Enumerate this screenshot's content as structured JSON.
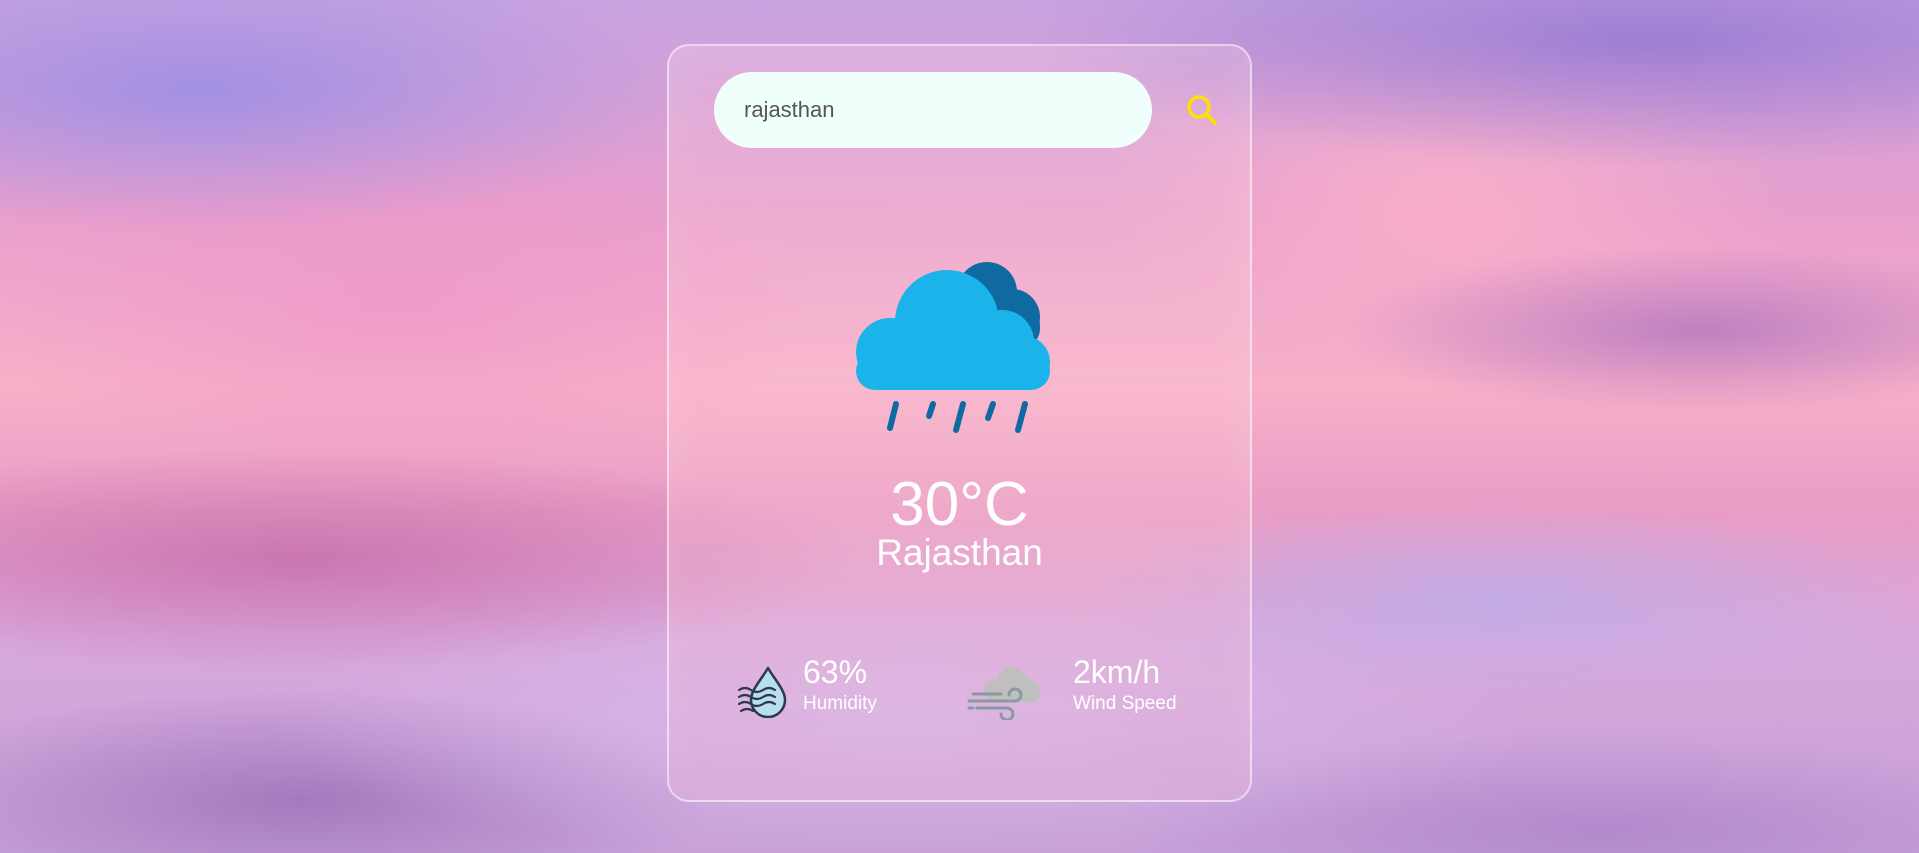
{
  "search": {
    "value": "rajasthan",
    "placeholder": "",
    "button_icon": "search-icon",
    "button_color": "#ffe100"
  },
  "weather": {
    "icon": "rain-cloud-icon",
    "temperature": "30°C",
    "city": "Rajasthan"
  },
  "details": {
    "humidity": {
      "icon": "humidity-icon",
      "value": "63%",
      "label": "Humidity"
    },
    "wind": {
      "icon": "wind-icon",
      "value": "2km/h",
      "label": "Wind Speed"
    }
  },
  "colors": {
    "cloud_front": "#1bb4ea",
    "cloud_back": "#0f6aa2",
    "rain": "#0f6aa2",
    "text": "#ffffff",
    "input_bg": "#f0fffb"
  }
}
